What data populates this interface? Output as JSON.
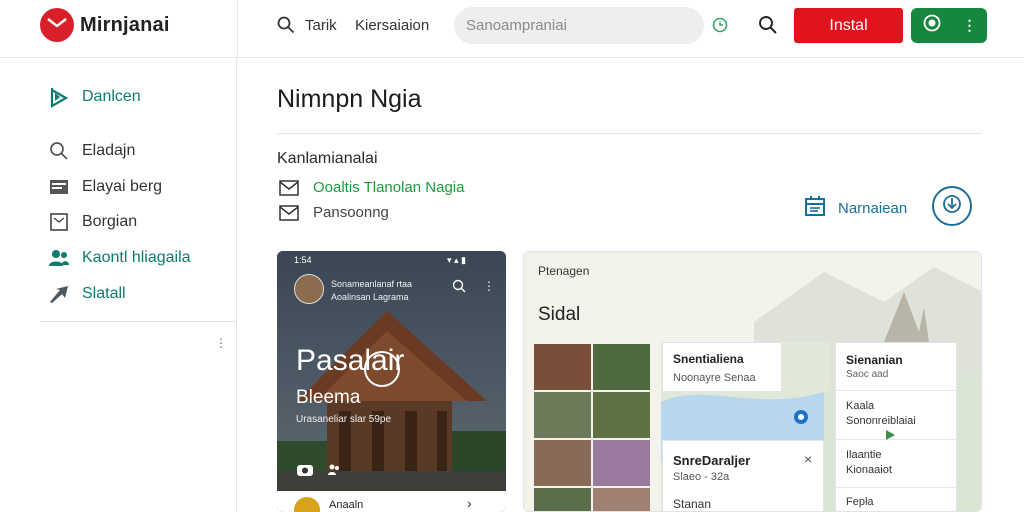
{
  "header": {
    "brand": "Mirnjanai",
    "nav": [
      "Tarik",
      "Kiersaiaion"
    ],
    "search_placeholder": "Sanoampraniai",
    "install_label": "Instal",
    "more_dots": "⋮"
  },
  "sidebar": {
    "items": [
      {
        "label": "Danlcen",
        "icon": "bookmark-icon",
        "active": true
      },
      {
        "label": "Eladajn",
        "icon": "search-icon",
        "active": false
      },
      {
        "label": "Elayai berg",
        "icon": "image-icon",
        "active": false
      },
      {
        "label": "Borgian",
        "icon": "inbox-icon",
        "active": false
      },
      {
        "label": "Kaontl hliagaila",
        "icon": "people-icon",
        "active": true
      },
      {
        "label": "Slatall",
        "icon": "send-icon",
        "active": true
      }
    ],
    "more": "⋮"
  },
  "main": {
    "title": "Nimnpn Ngia",
    "section_label": "Kanlamianalai",
    "options": [
      {
        "label": "Ooaltis Tlanolan Nagia",
        "highlight": true
      },
      {
        "label": "Pansoonng",
        "highlight": false
      }
    ],
    "calendar_link": "Narnaiean"
  },
  "phone": {
    "status_time": "1:54",
    "account_name": "Sonameanlanaf rtaa",
    "account_sub": "Aoalinsan Lagrama",
    "title": "Pasalair",
    "subtitle": "Bleema",
    "caption": "Urasaneliar slar 59pe",
    "footer_text": "Anaaln"
  },
  "map": {
    "label": "Ptenagen",
    "title": "Sidal",
    "card_main": {
      "title": "Snentialiena",
      "sub": "Noonayre Senaa"
    },
    "card_detail": {
      "title": "SnreDaraljer",
      "sub": "Slaeo - 32a",
      "foot": "Stanan"
    },
    "card_right": {
      "title": "Sienanian",
      "sub": "Saoc aad",
      "rows": [
        {
          "a": "Kaala",
          "b": "Sononreiblaiai"
        },
        {
          "a": "Ilaantie",
          "b": "Kionaaiot"
        },
        {
          "a": "Fepla",
          "b": ""
        }
      ]
    },
    "colors": {
      "water": "#b7d7ef",
      "land": "#dfe8d9"
    }
  },
  "colors": {
    "brand_red": "#d9202a",
    "install_red": "#e0141c",
    "green": "#17873f",
    "teal": "#0f7b6c",
    "link_blue": "#1a6f96"
  }
}
